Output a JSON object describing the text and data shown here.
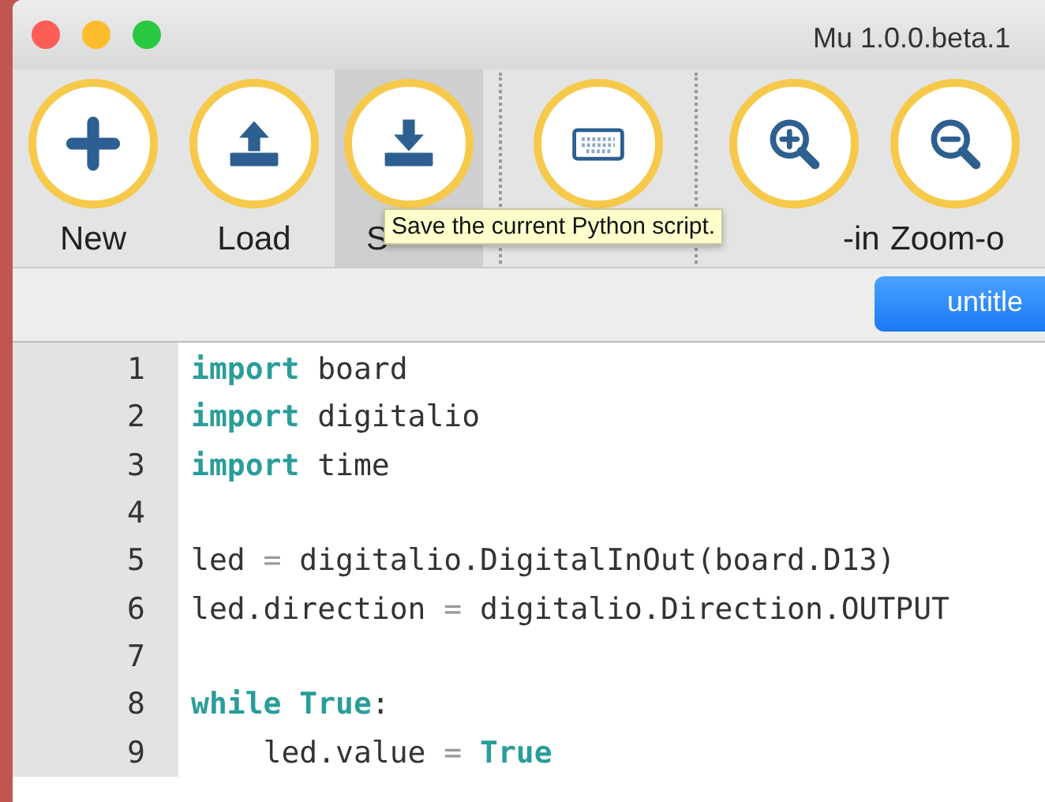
{
  "window": {
    "title": "Mu 1.0.0.beta.1"
  },
  "toolbar": {
    "buttons": [
      {
        "kind": "new",
        "label": "New",
        "selected": false
      },
      {
        "kind": "load",
        "label": "Load",
        "selected": false
      },
      {
        "kind": "save",
        "label": "S",
        "selected": true
      },
      {
        "kind": "repl",
        "selected": false,
        "separator_before": true
      },
      {
        "kind": "zoom-in",
        "label": "-in",
        "selected": false,
        "separator_before": true
      },
      {
        "kind": "zoom-out",
        "label": "Zoom-o",
        "selected": false
      }
    ],
    "tooltip": "Save the current Python script."
  },
  "tabs": [
    {
      "label": "untitle",
      "selected": true
    }
  ],
  "editor": {
    "lines": [
      {
        "number": "1",
        "tokens": [
          {
            "kind": "keyword",
            "text": "import"
          },
          {
            "kind": "name",
            "text": " board"
          }
        ]
      },
      {
        "number": "2",
        "tokens": [
          {
            "kind": "keyword",
            "text": "import"
          },
          {
            "kind": "name",
            "text": " digitalio"
          }
        ]
      },
      {
        "number": "3",
        "tokens": [
          {
            "kind": "keyword",
            "text": "import"
          },
          {
            "kind": "name",
            "text": " time"
          }
        ]
      },
      {
        "number": "4"
      },
      {
        "number": "5",
        "tokens": [
          {
            "kind": "name",
            "text": "led "
          },
          {
            "kind": "operator",
            "text": "="
          },
          {
            "kind": "name",
            "text": " digitalio.DigitalInOut(board.D13)"
          }
        ]
      },
      {
        "number": "6",
        "tokens": [
          {
            "kind": "name",
            "text": "led.direction "
          },
          {
            "kind": "operator",
            "text": "="
          },
          {
            "kind": "name",
            "text": " digitalio.Direction.OUTPUT"
          }
        ]
      },
      {
        "number": "7"
      },
      {
        "number": "8",
        "tokens": [
          {
            "kind": "keyword",
            "text": "while True"
          },
          {
            "kind": "name",
            "text": ":"
          }
        ]
      },
      {
        "number": "9",
        "tokens": [
          {
            "kind": "name",
            "text": "    led.value "
          },
          {
            "kind": "operator",
            "text": "="
          },
          {
            "kind": "keyword",
            "text": " True"
          }
        ]
      }
    ]
  }
}
